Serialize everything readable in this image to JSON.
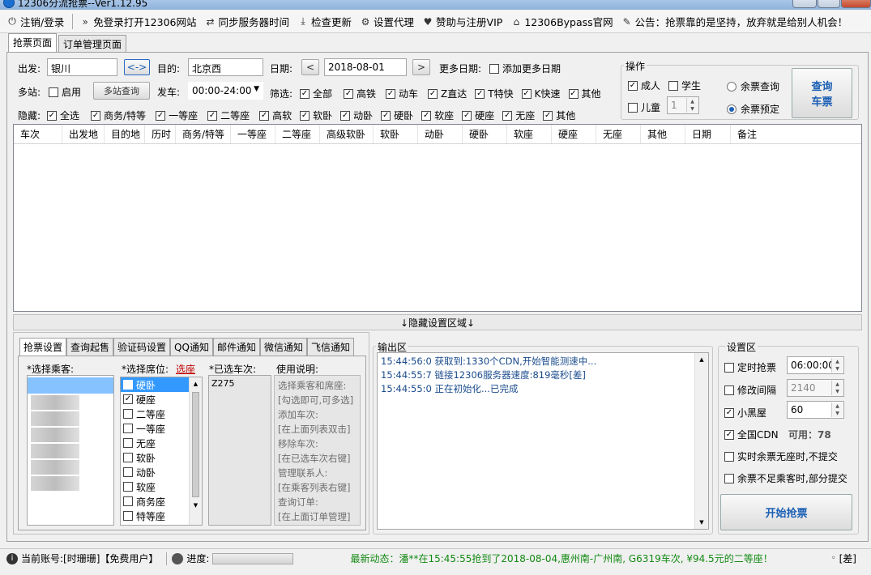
{
  "window": {
    "title": "12306分流抢票--Ver1.12.95"
  },
  "menu": {
    "items": [
      {
        "icon": "power-icon",
        "label": "注销/登录"
      },
      {
        "icon": "double-chevron-icon",
        "label": "免登录打开12306网站"
      },
      {
        "icon": "sync-icon",
        "label": "同步服务器时间"
      },
      {
        "icon": "download-icon",
        "label": "检查更新"
      },
      {
        "icon": "gear-icon",
        "label": "设置代理"
      },
      {
        "icon": "heart-icon",
        "label": "赞助与注册VIP"
      },
      {
        "icon": "home-icon",
        "label": "12306Bypass官网"
      },
      {
        "icon": "tag-icon",
        "label": "公告：抢票靠的是坚持，放弃就是给别人机会！"
      }
    ]
  },
  "tabs": {
    "ticket": "抢票页面",
    "orders": "订单管理页面"
  },
  "search": {
    "from_label": "出发:",
    "from_value": "银川",
    "swap_label": "<->",
    "to_label": "目的:",
    "to_value": "北京西",
    "date_label": "日期:",
    "date_value": "2018-08-01",
    "prev": "<",
    "next": ">",
    "more_dates_label": "更多日期:",
    "add_dates_label": "添加更多日期",
    "multi_label": "多站:",
    "enable_label": "启用",
    "multi_query_btn": "多站查询",
    "depart_label": "发车:",
    "depart_value": "00:00-24:00",
    "filter_label": "筛选:",
    "filters": [
      "全部",
      "高铁",
      "动车",
      "Z直达",
      "T特快",
      "K快速",
      "其他"
    ],
    "hide_label": "隐藏:",
    "hide_items": [
      "全选",
      "商务/特等",
      "一等座",
      "二等座",
      "高软",
      "软卧",
      "动卧",
      "硬卧",
      "软座",
      "硬座",
      "无座",
      "其他"
    ]
  },
  "ops": {
    "title": "操作",
    "adult": "成人",
    "student": "学生",
    "child": "儿童",
    "child_count": "1",
    "remain_query": "余票查询",
    "remain_reserve": "余票预定",
    "query_btn_l1": "查询",
    "query_btn_l2": "车票"
  },
  "grid": {
    "columns": [
      "车次",
      "出发地",
      "目的地",
      "历时",
      "商务/特等",
      "一等座",
      "二等座",
      "高级软卧",
      "软卧",
      "动卧",
      "硬卧",
      "软座",
      "硬座",
      "无座",
      "其他",
      "日期",
      "备注"
    ]
  },
  "hide_area": "↓隐藏设置区域↓",
  "bottom_tabs": [
    "抢票设置",
    "查询起售",
    "验证码设置",
    "QQ通知",
    "邮件通知",
    "微信通知",
    "飞信通知"
  ],
  "passengers": {
    "label": "*选择乘客:"
  },
  "seats": {
    "label": "*选择席位:",
    "link": "选座",
    "items": [
      {
        "name": "硬卧",
        "checked": false,
        "selected": true
      },
      {
        "name": "硬座",
        "checked": true,
        "selected": false
      },
      {
        "name": "二等座",
        "checked": false,
        "selected": false
      },
      {
        "name": "一等座",
        "checked": false,
        "selected": false
      },
      {
        "name": "无座",
        "checked": false,
        "selected": false
      },
      {
        "name": "软卧",
        "checked": false,
        "selected": false
      },
      {
        "name": "动卧",
        "checked": false,
        "selected": false
      },
      {
        "name": "软座",
        "checked": false,
        "selected": false
      },
      {
        "name": "商务座",
        "checked": false,
        "selected": false
      },
      {
        "name": "特等座",
        "checked": false,
        "selected": false
      }
    ]
  },
  "trains": {
    "label": "*已选车次:",
    "items": [
      "Z275"
    ]
  },
  "usage": {
    "label": "使用说明:",
    "lines": [
      "选择乘客和席座:",
      "[勾选即可,可多选]",
      "添加车次:",
      "[在上面列表双击]",
      "移除车次:",
      "[在已选车次右键]",
      "管理联系人:",
      "[在乘客列表右键]",
      "查询订单:",
      "[在上面订单管理]"
    ]
  },
  "output": {
    "label": "输出区",
    "lines": [
      "15:44:56:0  获取到:1330个CDN,开始智能测速中...",
      "15:44:55:7  链接12306服务器速度:819毫秒[差]",
      "15:44:55:0  正在初始化...已完成"
    ]
  },
  "settings": {
    "label": "设置区",
    "timed": "定时抢票",
    "timed_value": "06:00:00",
    "interval": "修改间隔",
    "interval_value": "2140",
    "blackroom": "小黑屋",
    "blackroom_value": "60",
    "cdn": "全国CDN",
    "cdn_avail": "可用：78",
    "opt1": "实时余票无座时,不提交",
    "opt2": "余票不足乘客时,部分提交",
    "start_btn": "开始抢票"
  },
  "status": {
    "account": "当前账号:[时珊珊]【免费用户】",
    "progress_label": "进度:",
    "news": "最新动态：潘**在15:45:55抢到了2018-08-04,惠州南-广州南, G6319车次, ¥94.5元的二等座！",
    "net": "[差]"
  },
  "colors": {
    "accent": "#1a5fb4",
    "news_green": "#138a13",
    "link_red": "#c00000",
    "log_blue": "#1a4b8c"
  }
}
